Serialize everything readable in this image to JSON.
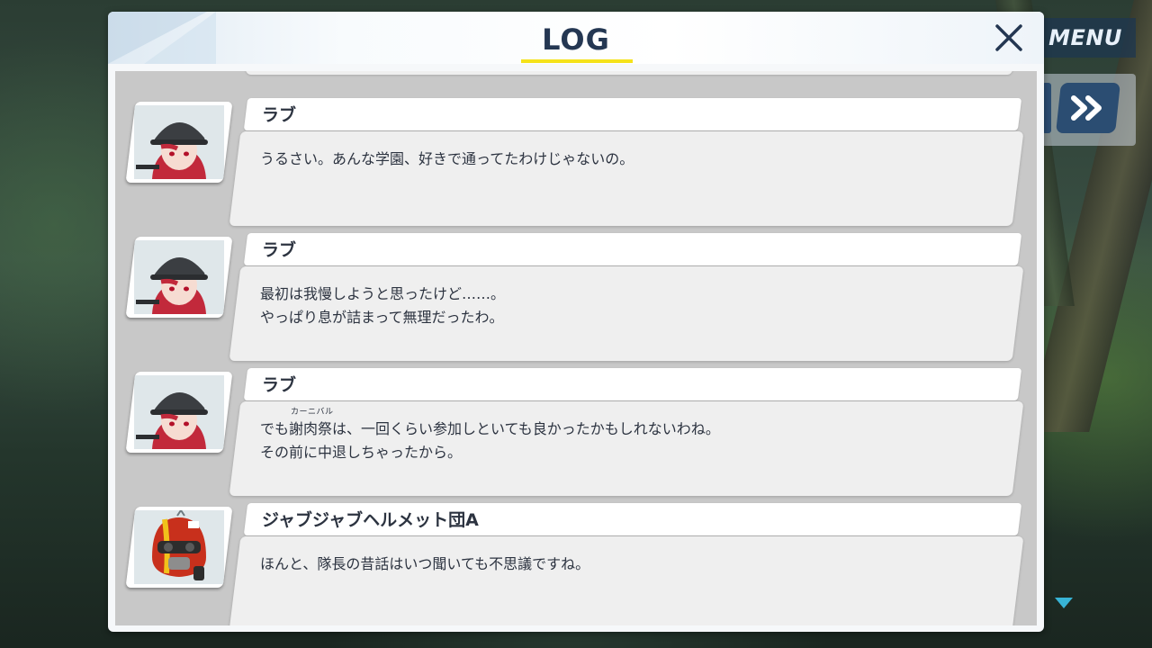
{
  "title": "LOG",
  "hud": {
    "menu_label": "MENU",
    "skip_icon": "double-chevron-right-icon",
    "scroll_icon": "triangle-down-icon"
  },
  "colors": {
    "title_underline": "#f5e21a",
    "title_text": "#243752",
    "button_blue": "#2b4d72",
    "scroll_arrow": "#38b4d6"
  },
  "entries": [
    {
      "speaker": "ラブ",
      "portrait": "helmet-girl-portrait",
      "lines": [
        "うるさい。あんな学園、好きで通ってたわけじゃないの。"
      ]
    },
    {
      "speaker": "ラブ",
      "portrait": "helmet-girl-portrait",
      "lines": [
        "最初は我慢しようと思ったけど……。",
        "やっぱり息が詰まって無理だったわ。"
      ]
    },
    {
      "speaker": "ラブ",
      "portrait": "helmet-girl-portrait",
      "line1_before": "でも",
      "line1_ruby_base": "謝肉祭",
      "line1_ruby": "カーニバル",
      "line1_after": "は、一回くらい参加しといても良かったかもしれないわね。",
      "lines": [
        "その前に中退しちゃったから。"
      ]
    },
    {
      "speaker": "ジャブジャブヘルメット団A",
      "portrait": "red-helmet-grunt-portrait",
      "lines": [
        "ほんと、隊長の昔話はいつ聞いても不思議ですね。"
      ]
    }
  ]
}
